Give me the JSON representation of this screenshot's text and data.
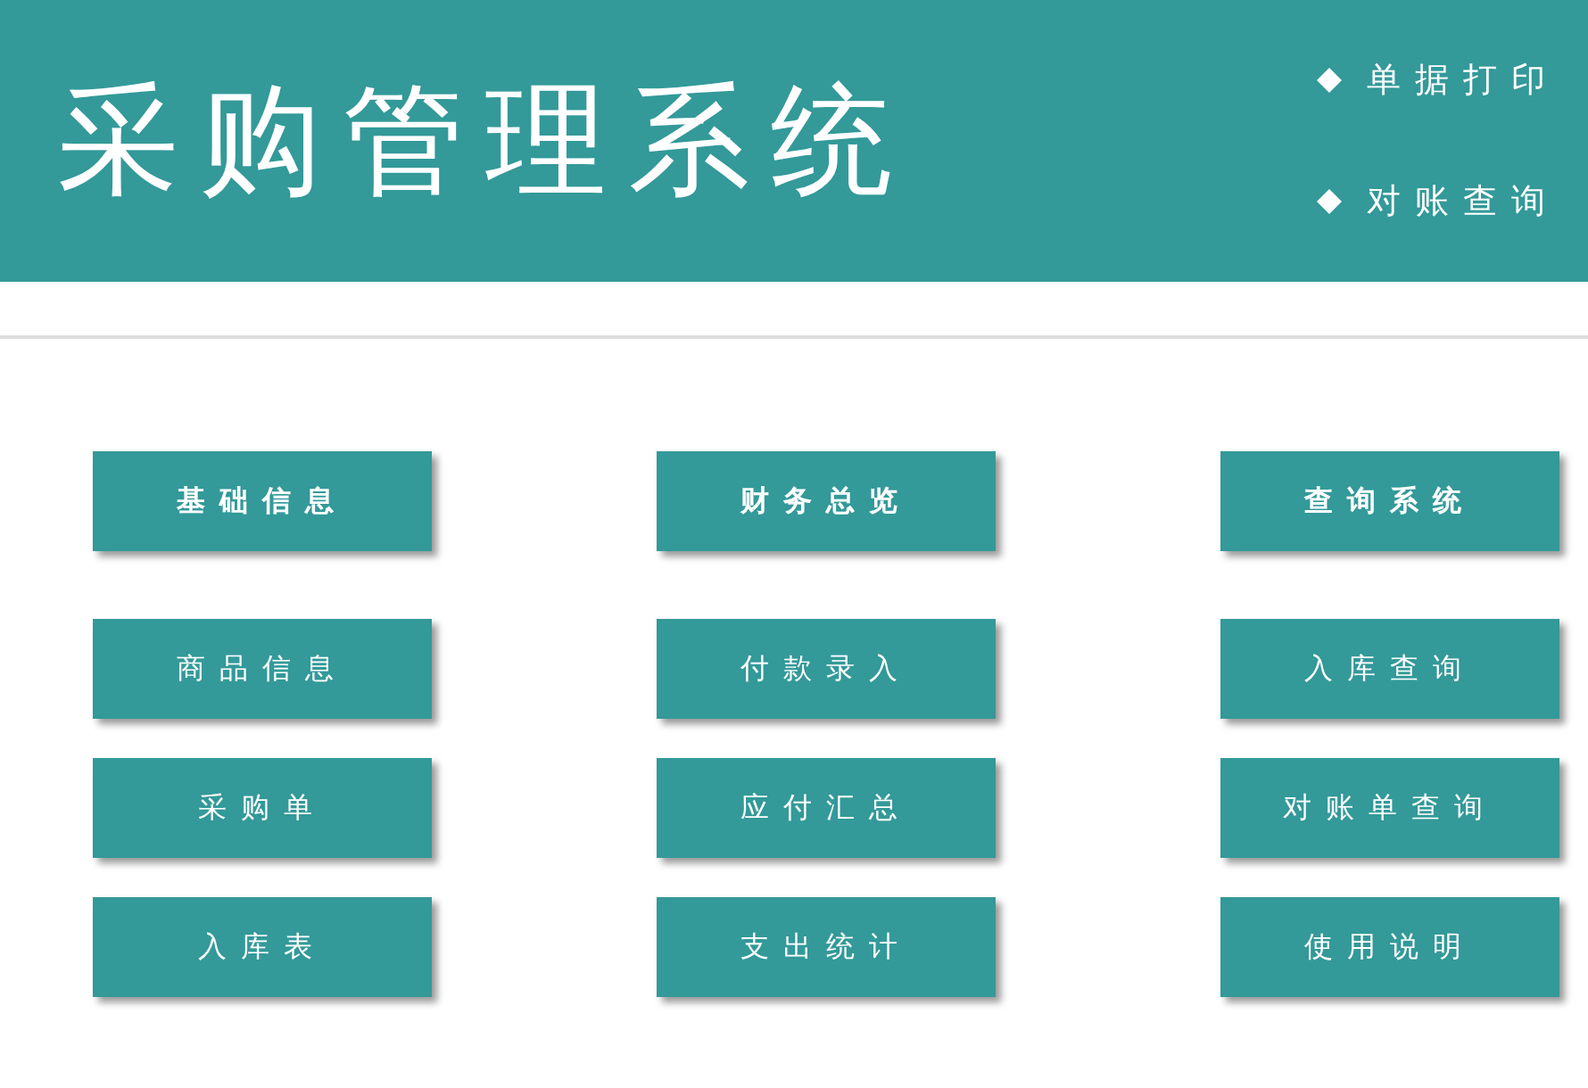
{
  "header": {
    "title": "采购管理系统",
    "links": [
      {
        "label": "单据打印"
      },
      {
        "label": "对账查询"
      }
    ]
  },
  "columns": [
    {
      "buttons": [
        {
          "label": "基础信息",
          "kind": "header"
        },
        {
          "label": "商品信息",
          "kind": "item"
        },
        {
          "label": "采购单",
          "kind": "item"
        },
        {
          "label": "入库表",
          "kind": "item"
        }
      ]
    },
    {
      "buttons": [
        {
          "label": "财务总览",
          "kind": "header"
        },
        {
          "label": "付款录入",
          "kind": "item"
        },
        {
          "label": "应付汇总",
          "kind": "item"
        },
        {
          "label": "支出统计",
          "kind": "item"
        }
      ]
    },
    {
      "buttons": [
        {
          "label": "查询系统",
          "kind": "header"
        },
        {
          "label": "入库查询",
          "kind": "item"
        },
        {
          "label": "对账单查询",
          "kind": "item"
        },
        {
          "label": "使用说明",
          "kind": "item"
        }
      ]
    }
  ]
}
